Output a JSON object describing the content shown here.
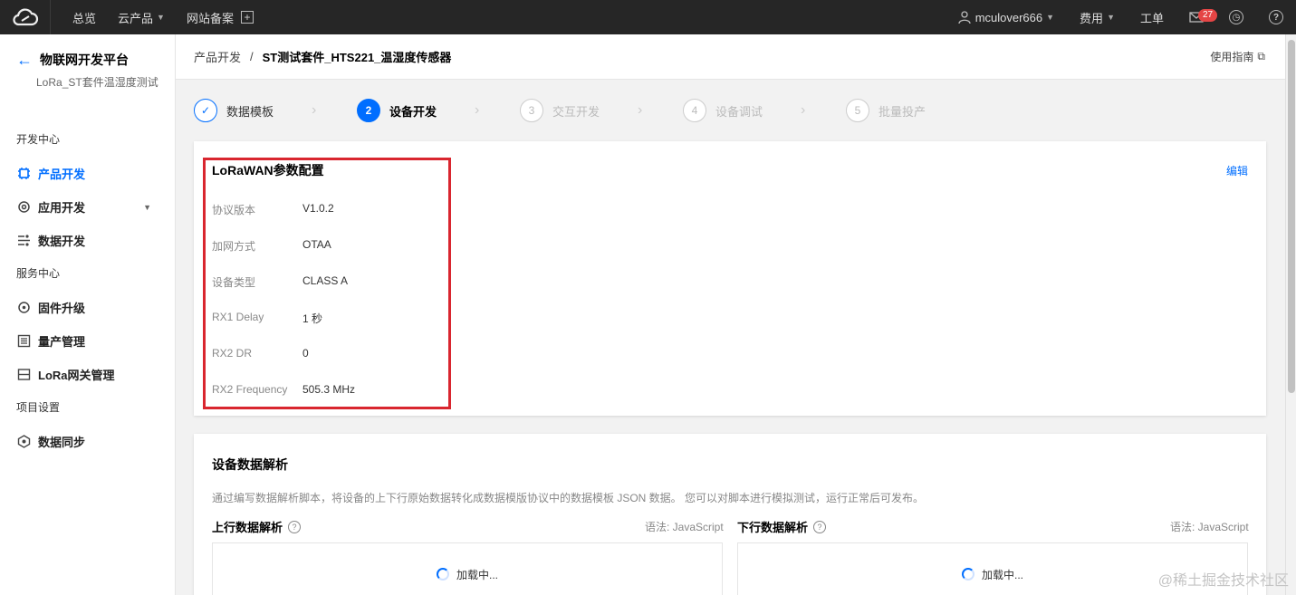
{
  "topbar": {
    "nav": [
      {
        "label": "总览"
      },
      {
        "label": "云产品"
      },
      {
        "label": "网站备案"
      }
    ],
    "user": "mculover666",
    "billing": "费用",
    "ticket": "工单",
    "mail_count": "27"
  },
  "sidebar": {
    "title": "物联网开发平台",
    "subtitle": "LoRa_ST套件温湿度测试",
    "groups": {
      "dev": "开发中心",
      "service": "服务中心",
      "project": "项目设置"
    },
    "items": {
      "product_dev": "产品开发",
      "app_dev": "应用开发",
      "data_dev": "数据开发",
      "firmware": "固件升级",
      "mass_prod": "量产管理",
      "lora_gw": "LoRa网关管理",
      "data_sync": "数据同步"
    }
  },
  "breadcrumb": {
    "parent": "产品开发",
    "sep": "/",
    "current": "ST测试套件_HTS221_温湿度传感器",
    "guide": "使用指南"
  },
  "steps": [
    {
      "num": "✓",
      "label": "数据模板"
    },
    {
      "num": "2",
      "label": "设备开发"
    },
    {
      "num": "3",
      "label": "交互开发"
    },
    {
      "num": "4",
      "label": "设备调试"
    },
    {
      "num": "5",
      "label": "批量投产"
    }
  ],
  "lorawan": {
    "title": "LoRaWAN参数配置",
    "edit": "编辑",
    "fields": [
      {
        "key": "协议版本",
        "value": "V1.0.2"
      },
      {
        "key": "加网方式",
        "value": "OTAA"
      },
      {
        "key": "设备类型",
        "value": "CLASS A"
      },
      {
        "key": "RX1 Delay",
        "value": "1 秒"
      },
      {
        "key": "RX2 DR",
        "value": "0"
      },
      {
        "key": "RX2 Frequency",
        "value": "505.3 MHz"
      }
    ]
  },
  "parse": {
    "title": "设备数据解析",
    "desc": "通过编写数据解析脚本，将设备的上下行原始数据转化成数据模版协议中的数据模板 JSON 数据。 您可以对脚本进行模拟测试，运行正常后可发布。",
    "up_title": "上行数据解析",
    "down_title": "下行数据解析",
    "syntax": "语法: JavaScript",
    "loading": "加载中..."
  },
  "watermark": "@稀土掘金技术社区",
  "colors": {
    "accent": "#006eff",
    "highlight": "#d9262f",
    "topbar": "#262626"
  }
}
